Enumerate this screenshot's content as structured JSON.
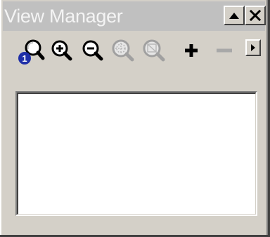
{
  "window": {
    "title": "View Manager"
  },
  "titlebar": {
    "buttons": [
      {
        "icon": "arrow-up-icon"
      },
      {
        "icon": "close-icon"
      }
    ]
  },
  "toolbar": {
    "tools": [
      {
        "icon": "find-view-icon",
        "enabled": true
      },
      {
        "icon": "zoom-in-icon",
        "enabled": true
      },
      {
        "icon": "zoom-out-icon",
        "enabled": true
      },
      {
        "icon": "zoom-extents-icon",
        "enabled": false
      },
      {
        "icon": "zoom-window-icon",
        "enabled": false
      },
      {
        "icon": "add-icon",
        "enabled": true
      },
      {
        "icon": "remove-icon",
        "enabled": false
      }
    ],
    "overflow_icon": "chevron-right-icon"
  },
  "views_list": {
    "items": []
  },
  "colors": {
    "face": "#d4d0c8",
    "titlebar": "#c0c0c0",
    "title_text": "#f4f4f4",
    "disabled_icon": "#a0a0a0",
    "accent_blue": "#1f2fa8"
  }
}
